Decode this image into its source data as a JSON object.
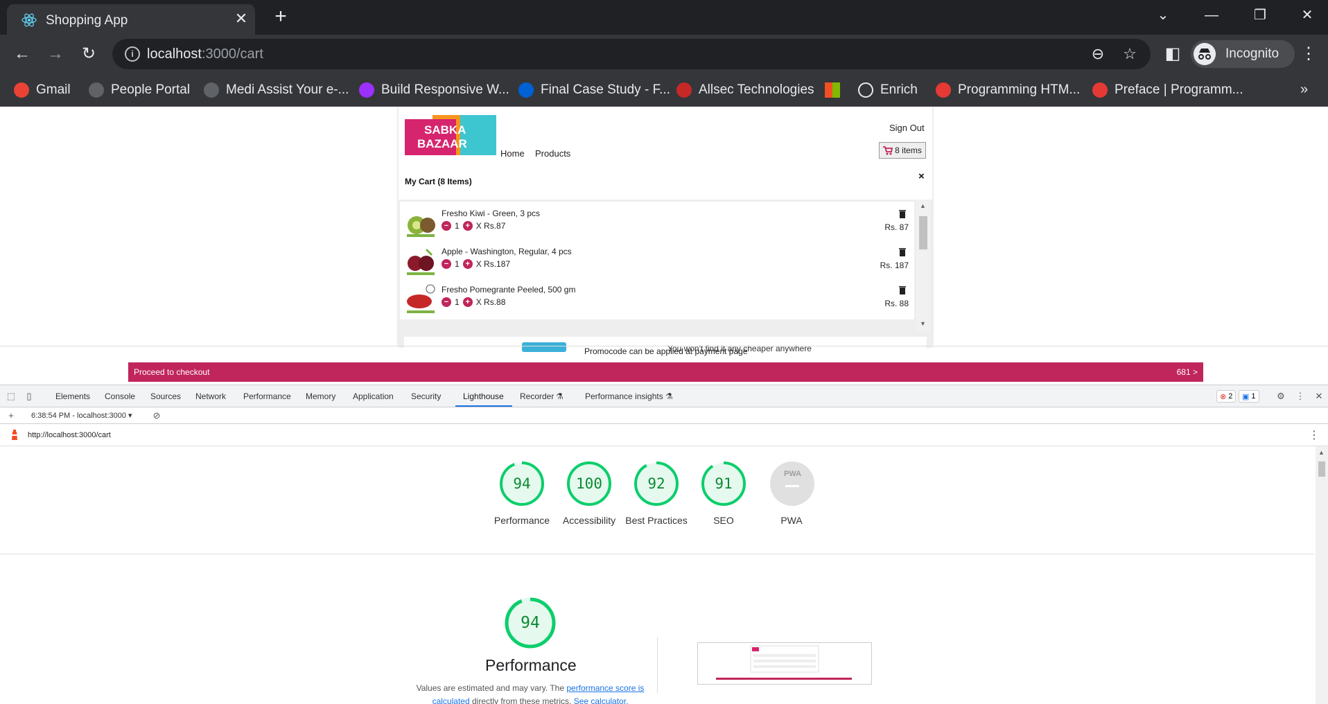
{
  "browser": {
    "tab_title": "Shopping App",
    "url_host": "localhost",
    "url_path": ":3000/cart",
    "profile_label": "Incognito",
    "bookmarks": [
      {
        "label": "Gmail",
        "color": "#ea4335"
      },
      {
        "label": "People Portal",
        "color": "#5f6368"
      },
      {
        "label": "Medi Assist Your e-...",
        "color": "#5f6368"
      },
      {
        "label": "Build Responsive W...",
        "color": "#9b30ff"
      },
      {
        "label": "Final Case Study - F...",
        "color": "#0061d5"
      },
      {
        "label": "Allsec Technologies",
        "color": "#c62828"
      },
      {
        "label": "",
        "color": "#f25022"
      },
      {
        "label": "Enrich",
        "color": "#202124"
      },
      {
        "label": "Programming HTM...",
        "color": "#e53935"
      },
      {
        "label": "Preface | Programm...",
        "color": "#e53935"
      }
    ]
  },
  "app": {
    "logo_line1": "SABKA",
    "logo_line2": "BAZAAR",
    "nav": {
      "home": "Home",
      "products": "Products"
    },
    "sign_out": "Sign Out",
    "cart_button": "8 items",
    "cart_title": "My Cart (8 Items)",
    "close": "×",
    "items": [
      {
        "name": "Fresho Kiwi - Green, 3 pcs",
        "qty": "1",
        "unit": "X Rs.87",
        "price": "Rs. 87",
        "img_color": "#8bb33a"
      },
      {
        "name": "Apple - Washington, Regular, 4 pcs",
        "qty": "1",
        "unit": "X Rs.187",
        "price": "Rs. 187",
        "img_color": "#8b1a2b"
      },
      {
        "name": "Fresho Pomegrante Peeled, 500 gm",
        "qty": "1",
        "unit": "X Rs.88",
        "price": "Rs. 88",
        "img_color": "#c62828"
      }
    ],
    "banner_text": "You won't find it any cheaper anywhere",
    "promo_note": "Promocode can be applied at payment page",
    "checkout_label": "Proceed to checkout",
    "checkout_total": "681 >",
    "accent": "#c0255b"
  },
  "devtools": {
    "tabs": [
      "Elements",
      "Console",
      "Sources",
      "Network",
      "Performance",
      "Memory",
      "Application",
      "Security",
      "Lighthouse",
      "Recorder",
      "Performance insights"
    ],
    "active_tab": "Lighthouse",
    "errors": "2",
    "messages": "1",
    "report_selector": "6:38:54 PM - localhost:3000",
    "report_url": "http://localhost:3000/cart",
    "scores": [
      {
        "value": 94,
        "label": "Performance"
      },
      {
        "value": 100,
        "label": "Accessibility"
      },
      {
        "value": 92,
        "label": "Best Practices"
      },
      {
        "value": 91,
        "label": "SEO"
      },
      {
        "value": null,
        "label": "PWA"
      }
    ],
    "pwa_badge": "PWA",
    "big_score": 94,
    "big_title": "Performance",
    "desc_prefix": "Values are estimated and may vary. The ",
    "desc_link1": "performance score is calculated",
    "desc_middle": " directly from these metrics. ",
    "desc_link2": "See calculator.",
    "good_color": "#0cce6b"
  }
}
